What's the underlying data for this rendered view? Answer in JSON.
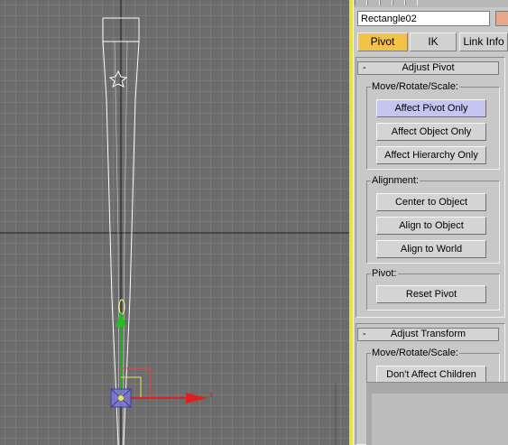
{
  "viewport": {
    "axis_x_label": "x",
    "object_name": "Rectangle02"
  },
  "panel": {
    "name_value": "Rectangle02",
    "swatch_color": "#e6a98c",
    "tabs": [
      {
        "label": "Pivot",
        "active": true
      },
      {
        "label": "IK",
        "active": false
      },
      {
        "label": "Link Info",
        "active": false
      }
    ],
    "adjust_pivot": {
      "header": "Adjust Pivot",
      "collapse_sign": "-",
      "move_rotate_scale": {
        "label": "Move/Rotate/Scale:",
        "buttons": [
          "Affect Pivot Only",
          "Affect Object Only",
          "Affect Hierarchy Only"
        ]
      },
      "alignment": {
        "label": "Alignment:",
        "buttons": [
          "Center to Object",
          "Align to Object",
          "Align to World"
        ]
      },
      "pivot": {
        "label": "Pivot:",
        "buttons": [
          "Reset Pivot"
        ]
      }
    },
    "adjust_transform": {
      "header": "Adjust Transform",
      "collapse_sign": "-",
      "move_rotate_scale": {
        "label": "Move/Rotate/Scale:",
        "buttons": [
          "Don't Affect Children"
        ]
      }
    }
  },
  "colors": {
    "viewport_bg": "#6c6c6c",
    "active_tab": "#f2c24a",
    "pressed_button": "#c5c5f2",
    "viewport_border": "#e8e23a",
    "axis_x": "#e02020",
    "axis_y": "#20b020"
  }
}
